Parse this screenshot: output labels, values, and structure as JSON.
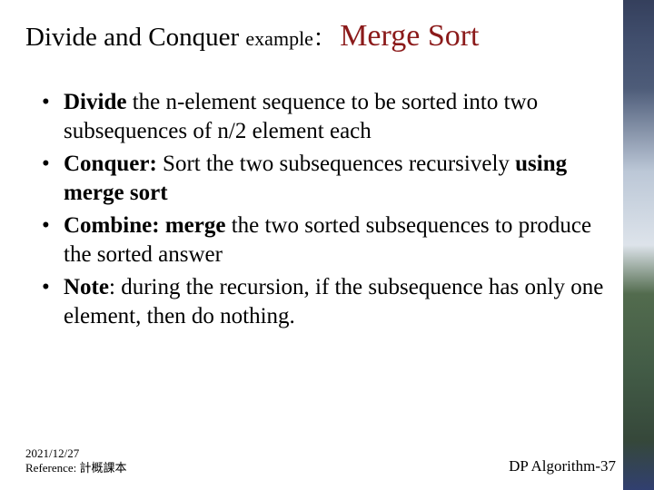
{
  "title": {
    "part1": "Divide and Conquer ",
    "small": "example：",
    "accent": "Merge Sort"
  },
  "points": [
    {
      "label": "Divide",
      "sep": " ",
      "text": "the n-element sequence to be sorted into two subsequences of n/2 element each"
    },
    {
      "label": "Conquer:",
      "sep": " ",
      "text_pre": "Sort the two subsequences recursively ",
      "text_strong": "using merge sort",
      "text_post": ""
    },
    {
      "label": "Combine:",
      "sep": " ",
      "text_pre": "",
      "text_strong": "merge",
      "text_post": " the two sorted subsequences to produce the sorted answer"
    },
    {
      "label": "Note",
      "sep": ": ",
      "text": "during the recursion, if the subsequence has only one element, then do nothing."
    }
  ],
  "footer": {
    "date": "2021/12/27",
    "reference": "Reference: 計概課本",
    "page": "DP Algorithm-37"
  }
}
